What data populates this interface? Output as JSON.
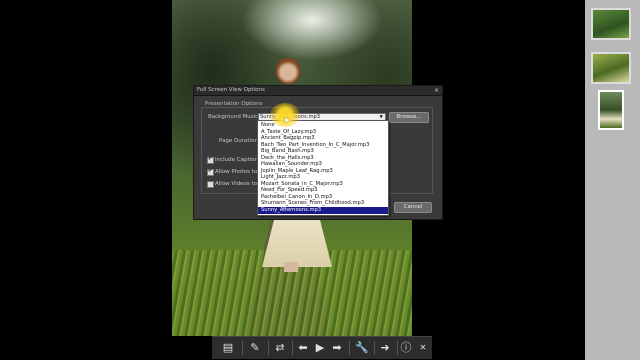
{
  "dialog": {
    "title": "Full Screen View Options",
    "close_label": "×",
    "section_label": "Presentation Options",
    "background_music_label": "Background Music:",
    "background_music_value": "Sunny_Afternoons.mp3",
    "browse_label": "Browse...",
    "page_duration_label": "Page Duration:",
    "include_captions_label": "Include Captions",
    "allow_photos_label": "Allow Photos to R",
    "allow_videos_label": "Allow Videos to Pl",
    "partial_text": "ly",
    "cancel_label": "Cancel",
    "checkbox_states": [
      true,
      true,
      false
    ]
  },
  "dropdown": {
    "items": [
      "None",
      "A_Taste_Of_Lazy.mp3",
      "Ancient_Bagpip.mp3",
      "Bach_Two_Part_Invention_In_C_Major.mp3",
      "Big_Band_Bash.mp3",
      "Deck_the_Halls.mp3",
      "Hawaiian_Sounder.mp3",
      "Joplin_Maple_Leaf_Rag.mp3",
      "Light_Jazz.mp3",
      "Mozart_Sonata_in_C_Major.mp3",
      "Need_For_Speed.mp3",
      "Pachelbel_Canon_In_D.mp3",
      "Shumann_Scenes_From_Childhood.mp3",
      "Sunny_Afternoons.mp3"
    ],
    "selected_index": 13
  },
  "toolbar": {
    "icons": [
      "filmstrip-icon",
      "edit-icon",
      "shuffle-icon",
      "previous-icon",
      "play-icon",
      "next-icon",
      "settings-icon",
      "forward-icon",
      "info-icon",
      "close-icon"
    ],
    "glyphs": [
      "▤",
      "✎",
      "⇄",
      "⬅",
      "▶",
      "➡",
      "🔧",
      "➜",
      "ⓘ",
      "✕"
    ]
  },
  "colors": {
    "dialog_bg": "#3a3a3a",
    "selection": "#1a1a8a",
    "highlight_glow": "#ffd728"
  }
}
